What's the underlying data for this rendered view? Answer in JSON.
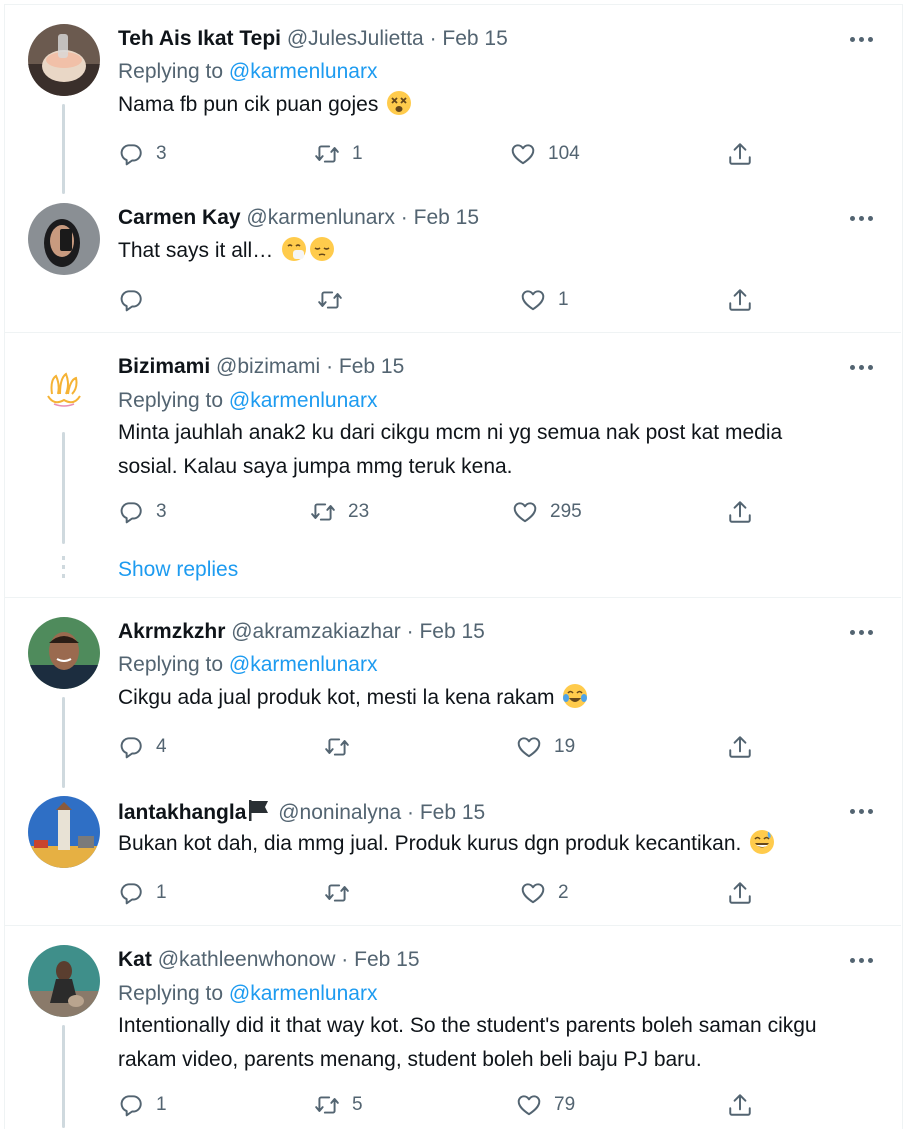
{
  "colors": {
    "accent": "#1d9bf0",
    "muted": "#536471",
    "text": "#0f1419",
    "border": "#eff3f4"
  },
  "tweets": [
    {
      "name": "Teh Ais Ikat Tepi",
      "handle": "@JulesJulietta",
      "date": "Feb 15",
      "replying_label": "Replying to",
      "replying_handle": "@karmenlunarx",
      "text": "Nama fb pun cik puan gojes",
      "emoji": "dizzy-face",
      "replies": "3",
      "retweets": "1",
      "likes": "104"
    },
    {
      "name": "Carmen Kay",
      "handle": "@karmenlunarx",
      "date": "Feb 15",
      "text": "That says it all…",
      "emoji": "sneezing-and-pensive-faces",
      "replies": "",
      "retweets": "",
      "likes": "1"
    },
    {
      "name": "Bizimami",
      "handle": "@bizimami",
      "date": "Feb 15",
      "replying_label": "Replying to",
      "replying_handle": "@karmenlunarx",
      "text": "Minta jauhlah anak2 ku dari cikgu mcm ni yg semua nak post kat media sosial. Kalau saya jumpa mmg teruk kena.",
      "replies": "3",
      "retweets": "23",
      "likes": "295",
      "show_replies": "Show replies"
    },
    {
      "name": "Akrmzkzhr",
      "handle": "@akramzakiazhar",
      "date": "Feb 15",
      "replying_label": "Replying to",
      "replying_handle": "@karmenlunarx",
      "text": "Cikgu ada jual produk kot, mesti la kena rakam",
      "emoji": "tears-of-joy",
      "replies": "4",
      "retweets": "",
      "likes": "19"
    },
    {
      "name": "lantakhangla",
      "name_emoji": "black-flag-icon",
      "handle": "@noninalyna",
      "date": "Feb 15",
      "text": "Bukan kot dah, dia mmg jual. Produk kurus dgn produk kecantikan.",
      "emoji": "grinning-sweat",
      "replies": "1",
      "retweets": "",
      "likes": "2"
    },
    {
      "name": "Kat",
      "handle": "@kathleenwhonow",
      "date": "Feb 15",
      "replying_label": "Replying to",
      "replying_handle": "@karmenlunarx",
      "text": "Intentionally did it that way kot. So the student's parents boleh saman cikgu rakam video, parents menang, student boleh beli baju PJ baru.",
      "replies": "1",
      "retweets": "5",
      "likes": "79"
    }
  ]
}
